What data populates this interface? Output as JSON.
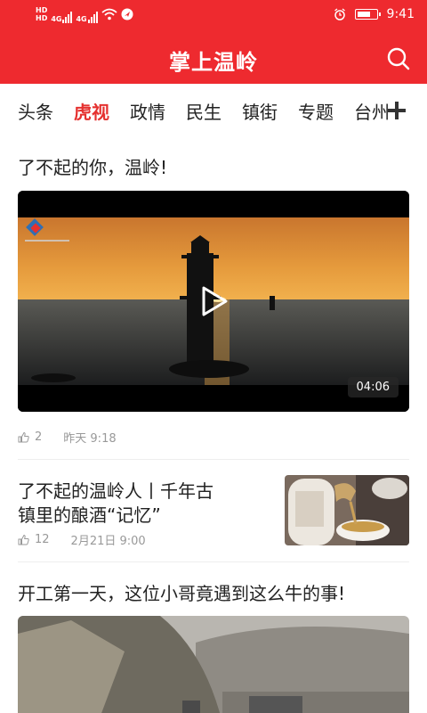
{
  "status_bar": {
    "hd1": "HD",
    "hd2": "HD",
    "net1": "4G",
    "net2": "4G",
    "time": "9:41"
  },
  "header": {
    "title": "掌上温岭",
    "bg_color": "#ee2a2f"
  },
  "tabs": [
    {
      "label": "头条",
      "active": false
    },
    {
      "label": "虎视",
      "active": true
    },
    {
      "label": "政情",
      "active": false
    },
    {
      "label": "民生",
      "active": false
    },
    {
      "label": "镇街",
      "active": false
    },
    {
      "label": "专题",
      "active": false
    },
    {
      "label": "台州",
      "active": false
    }
  ],
  "feed": [
    {
      "title": "了不起的你，温岭!",
      "type": "video",
      "duration": "04:06",
      "likes": "2",
      "time": "昨天 9:18"
    },
    {
      "title_line1": "了不起的温岭人丨千年古",
      "title_line2": "镇里的酿酒“记忆”",
      "type": "thumbnail",
      "likes": "12",
      "time": "2月21日 9:00"
    },
    {
      "title": "开工第一天，这位小哥竟遇到这么牛的事!",
      "type": "image"
    }
  ],
  "icons": {
    "search": "search-icon",
    "add_channel": "plus-icon",
    "like": "thumb-up-icon",
    "play": "play-icon"
  },
  "colors": {
    "accent": "#e5312f",
    "meta_text": "#999999"
  }
}
